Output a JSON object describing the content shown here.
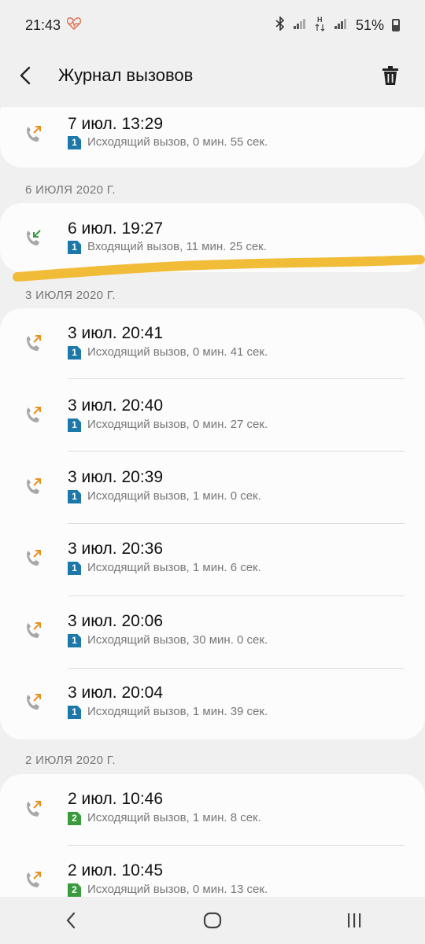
{
  "status_bar": {
    "time": "21:43",
    "health_icon": "heart-pulse-icon",
    "bluetooth_icon": "bluetooth-icon",
    "battery_percent": "51%"
  },
  "app_bar": {
    "title": "Журнал вызовов",
    "back_icon": "back-arrow-icon",
    "delete_icon": "trash-icon"
  },
  "sections": [
    {
      "header": "",
      "calls": [
        {
          "time": "7 июл. 13:29",
          "direction": "outgoing",
          "sim": "1",
          "desc": "Исходящий вызов, 0 мин. 55 сек."
        }
      ]
    },
    {
      "header": "6 ИЮЛЯ 2020 Г.",
      "calls": [
        {
          "time": "6 июл. 19:27",
          "direction": "incoming",
          "sim": "1",
          "desc": "Входящий вызов, 11 мин. 25 сек."
        }
      ]
    },
    {
      "header": "3 ИЮЛЯ 2020 Г.",
      "calls": [
        {
          "time": "3 июл. 20:41",
          "direction": "outgoing",
          "sim": "1",
          "desc": "Исходящий вызов, 0 мин. 41 сек."
        },
        {
          "time": "3 июл. 20:40",
          "direction": "outgoing",
          "sim": "1",
          "desc": "Исходящий вызов, 0 мин. 27 сек."
        },
        {
          "time": "3 июл. 20:39",
          "direction": "outgoing",
          "sim": "1",
          "desc": "Исходящий вызов, 1 мин. 0 сек."
        },
        {
          "time": "3 июл. 20:36",
          "direction": "outgoing",
          "sim": "1",
          "desc": "Исходящий вызов, 1 мин. 6 сек."
        },
        {
          "time": "3 июл. 20:06",
          "direction": "outgoing",
          "sim": "1",
          "desc": "Исходящий вызов, 30 мин. 0 сек."
        },
        {
          "time": "3 июл. 20:04",
          "direction": "outgoing",
          "sim": "1",
          "desc": "Исходящий вызов, 1 мин. 39 сек."
        }
      ]
    },
    {
      "header": "2 ИЮЛЯ 2020 Г.",
      "calls": [
        {
          "time": "2 июл. 10:46",
          "direction": "outgoing",
          "sim": "2",
          "desc": "Исходящий вызов, 1 мин. 8 сек."
        },
        {
          "time": "2 июл. 10:45",
          "direction": "outgoing",
          "sim": "2",
          "desc": "Исходящий вызов, 0 мин. 13 сек."
        }
      ]
    }
  ],
  "colors": {
    "outgoing_arrow": "#e8901e",
    "incoming_arrow": "#3a9a3e",
    "sim1": "#1c78a8",
    "sim2": "#3a9a3e",
    "highlight_stroke": "#f0b623"
  },
  "nav_bar": {
    "back_icon": "nav-back-icon",
    "home_icon": "nav-home-icon",
    "recents_icon": "nav-recents-icon"
  }
}
